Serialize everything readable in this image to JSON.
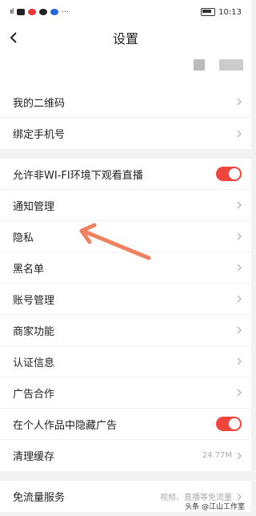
{
  "status": {
    "signal": "ııl",
    "time": "10:13",
    "more": "···"
  },
  "nav": {
    "title": "设置"
  },
  "groups": [
    {
      "rows": [
        {
          "label": "我的二维码"
        },
        {
          "label": "绑定手机号"
        }
      ]
    },
    {
      "rows": [
        {
          "label": "允许非WI-FI环境下观看直播",
          "toggle": true
        },
        {
          "label": "通知管理"
        },
        {
          "label": "隐私"
        },
        {
          "label": "黑名单"
        },
        {
          "label": "账号管理"
        },
        {
          "label": "商家功能"
        },
        {
          "label": "认证信息"
        },
        {
          "label": "广告合作"
        },
        {
          "label": "在个人作品中隐藏广告",
          "toggle": true
        },
        {
          "label": "清理缓存",
          "value": "24.77M"
        }
      ]
    },
    {
      "rows": [
        {
          "label": "免流量服务",
          "value": "视频、直播等免流量"
        }
      ]
    }
  ],
  "watermark": "头条 @江山工作室",
  "colors": {
    "toggle_on": "#f0453b",
    "annotation_arrow": "#ef8160"
  }
}
